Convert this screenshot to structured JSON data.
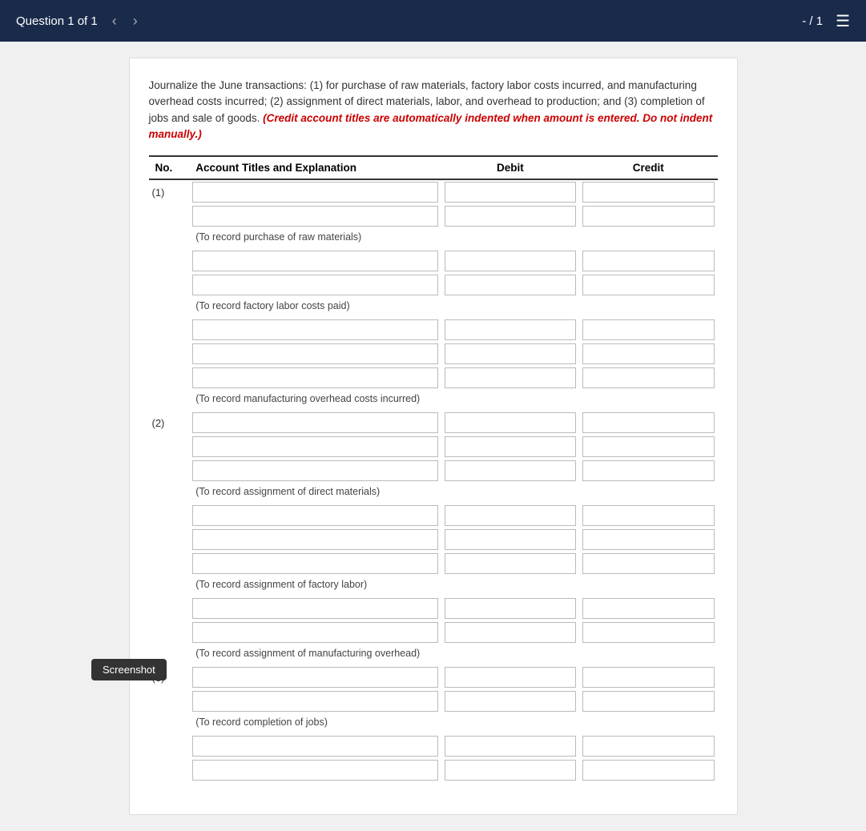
{
  "topBar": {
    "questionLabel": "Question 1 of 1",
    "pageCount": "- / 1",
    "prevArrow": "‹",
    "nextArrow": "›",
    "listIcon": "☰"
  },
  "instructions": {
    "main": "Journalize the June transactions: (1) for purchase of raw materials, factory labor costs incurred, and manufacturing overhead costs incurred; (2) assignment of direct materials, labor, and overhead to production; and (3) completion of jobs and sale of goods.",
    "note": "(Credit account titles are automatically indented when amount is entered. Do not indent manually.)"
  },
  "table": {
    "col_no": "No.",
    "col_account": "Account Titles and Explanation",
    "col_debit": "Debit",
    "col_credit": "Credit"
  },
  "sections": [
    {
      "id": "1",
      "label": "(1)",
      "groups": [
        {
          "rows": 2,
          "note": "(To record purchase of raw materials)"
        },
        {
          "rows": 2,
          "note": "(To record factory labor costs paid)"
        },
        {
          "rows": 3,
          "note": "(To record manufacturing overhead costs incurred)"
        }
      ]
    },
    {
      "id": "2",
      "label": "(2)",
      "groups": [
        {
          "rows": 3,
          "note": "(To record assignment of direct materials)"
        },
        {
          "rows": 3,
          "note": "(To record assignment of factory labor)"
        },
        {
          "rows": 2,
          "note": "(To record assignment of manufacturing overhead)"
        }
      ]
    },
    {
      "id": "3",
      "label": "(3)",
      "groups": [
        {
          "rows": 2,
          "note": "(To record completion of jobs)"
        },
        {
          "rows": 2,
          "note": ""
        }
      ]
    }
  ],
  "screenshot": {
    "label": "Screenshot"
  }
}
